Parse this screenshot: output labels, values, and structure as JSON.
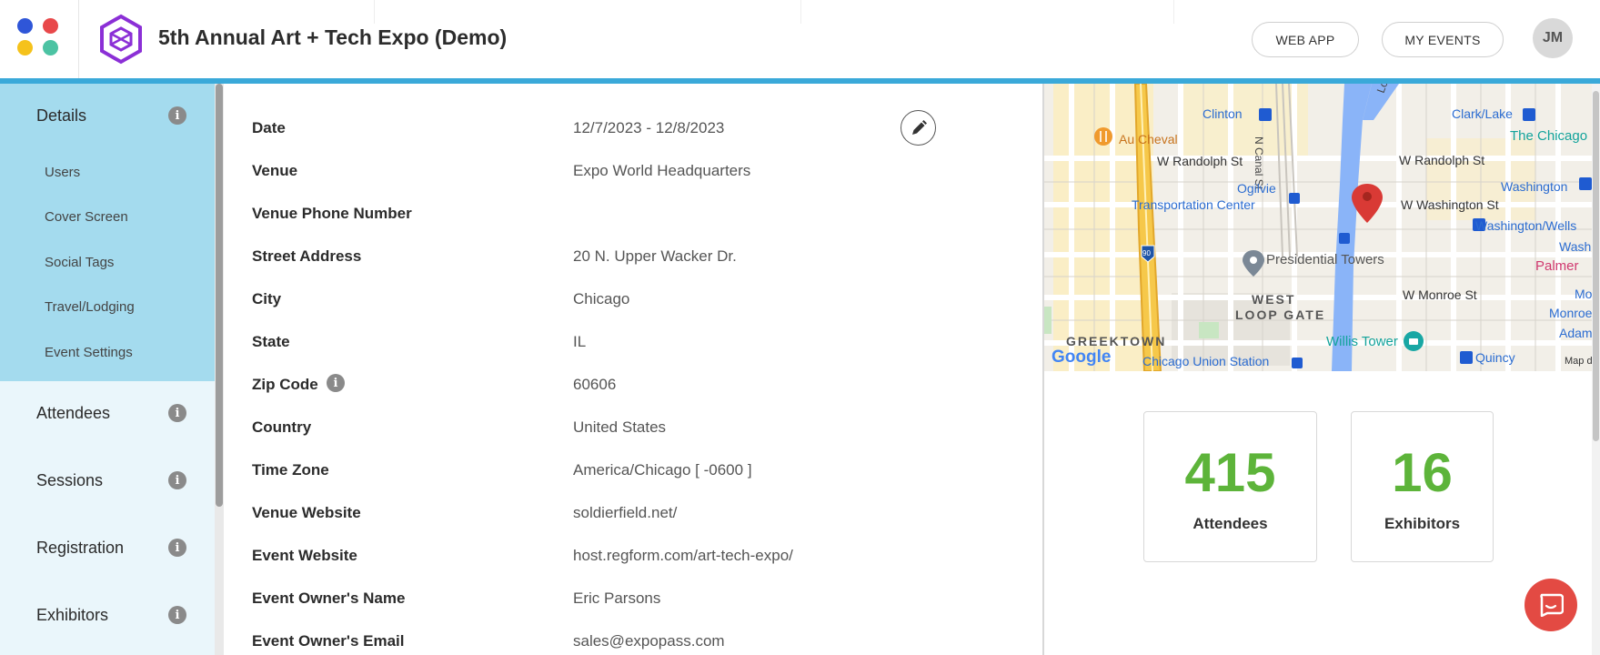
{
  "header": {
    "event_title": "5th Annual Art + Tech Expo (Demo)",
    "web_app_label": "WEB APP",
    "my_events_label": "MY EVENTS",
    "avatar_initials": "JM",
    "accent_color": "#3aa9d9"
  },
  "sidebar": {
    "details": "Details",
    "sub_items": [
      "Users",
      "Cover Screen",
      "Social Tags",
      "Travel/Lodging",
      "Event Settings"
    ],
    "sections": [
      "Attendees",
      "Sessions",
      "Registration",
      "Exhibitors"
    ],
    "active_color": "#a4dbee"
  },
  "details": {
    "rows": [
      {
        "label": "Date",
        "value": "12/7/2023 - 12/8/2023"
      },
      {
        "label": "Venue",
        "value": "Expo World Headquarters"
      },
      {
        "label": "Venue Phone Number",
        "value": ""
      },
      {
        "label": "Street Address",
        "value": "20 N. Upper Wacker Dr."
      },
      {
        "label": "City",
        "value": "Chicago"
      },
      {
        "label": "State",
        "value": "IL"
      },
      {
        "label": "Zip Code",
        "value": "60606"
      },
      {
        "label": "Country",
        "value": "United States"
      },
      {
        "label": "Time Zone",
        "value": "America/Chicago [ -0600 ]"
      },
      {
        "label": "Venue Website",
        "value": "soldierfield.net/"
      },
      {
        "label": "Event Website",
        "value": "host.regform.com/art-tech-expo/"
      },
      {
        "label": "Event Owner's Name",
        "value": "Eric Parsons"
      },
      {
        "label": "Event Owner's Email",
        "value": "sales@expopass.com"
      }
    ]
  },
  "map": {
    "labels": {
      "clinton": "Clinton",
      "au_cheval": "Au Cheval",
      "w_randolph_1": "W Randolph St",
      "n_canal": "N Canal St",
      "lower_wacker": "Lower Wacker",
      "w_randolph_2": "W Randolph St",
      "clark_lake": "Clark/Lake",
      "the_chicago": "The Chicago",
      "ogilvie": "Ogilvie",
      "transportation_center": "Transportation Center",
      "w_washington": "W Washington St",
      "washington": "Washington",
      "washington_wells": "Washington/Wells",
      "washi": "Washin",
      "presidential_towers": "Presidential Towers",
      "palmer": "Palmer",
      "west": "WEST",
      "loop_gate": "LOOP GATE",
      "w_monroe": "W Monroe St",
      "mor": "Mor",
      "monroe": "Monroe",
      "adam": "Adam",
      "greektown": "GREEKTOWN",
      "willis_tower": "Willis Tower",
      "google": "Google",
      "union_station": "Chicago Union Station",
      "quincy": "Quincy",
      "map_data": "Map d",
      "i90": "90"
    }
  },
  "stats": {
    "attendees_count": "415",
    "attendees_label": "Attendees",
    "exhibitors_count": "16",
    "exhibitors_label": "Exhibitors",
    "number_color": "#5db43a"
  }
}
